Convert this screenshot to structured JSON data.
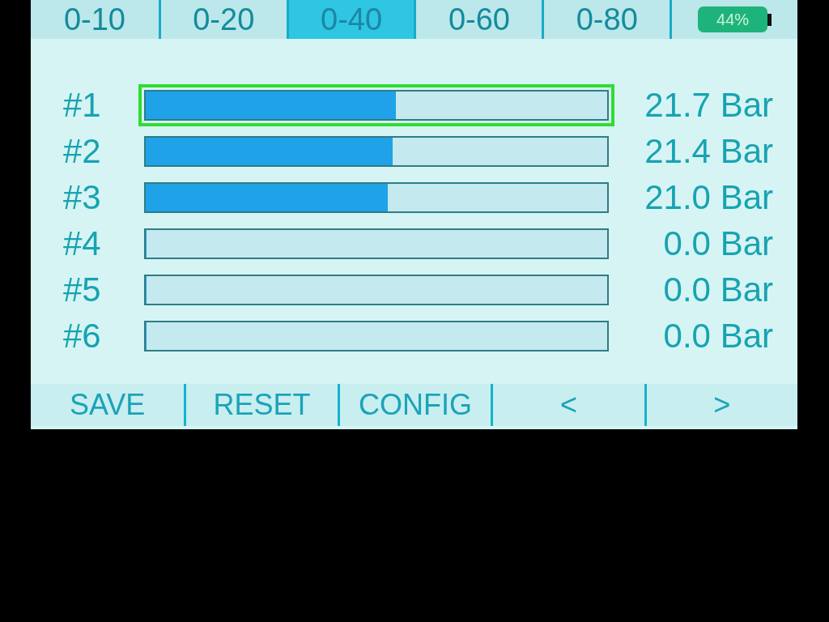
{
  "tabs": [
    {
      "label": "0-10",
      "selected": false
    },
    {
      "label": "0-20",
      "selected": false
    },
    {
      "label": "0-40",
      "selected": true
    },
    {
      "label": "0-60",
      "selected": false
    },
    {
      "label": "0-80",
      "selected": false
    }
  ],
  "battery": {
    "text": "44%"
  },
  "channels": [
    {
      "label": "#1",
      "level": 0.5425,
      "reading": "21.7 Bar",
      "selected": true
    },
    {
      "label": "#2",
      "level": 0.535,
      "reading": "21.4 Bar",
      "selected": false
    },
    {
      "label": "#3",
      "level": 0.525,
      "reading": "21.0 Bar",
      "selected": false
    },
    {
      "label": "#4",
      "level": 0,
      "reading": "0.0 Bar",
      "selected": false
    },
    {
      "label": "#5",
      "level": 0,
      "reading": "0.0 Bar",
      "selected": false
    },
    {
      "label": "#6",
      "level": 0,
      "reading": "0.0 Bar",
      "selected": false
    }
  ],
  "buttons": [
    "SAVE",
    "RESET",
    "CONFIG",
    "<",
    ">"
  ]
}
